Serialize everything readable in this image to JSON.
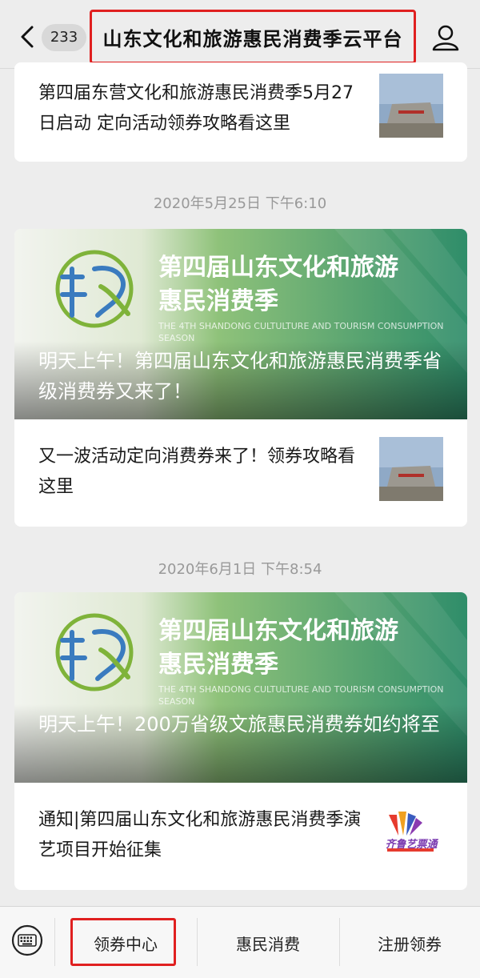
{
  "header": {
    "unread_count": "233",
    "title": "山东文化和旅游惠民消费季云平台",
    "back_icon": "chevron-left-icon",
    "profile_icon": "person-icon"
  },
  "feed": {
    "item0": {
      "text": "第四届东营文化和旅游惠民消费季5月27日启动 定向活动领券攻略看这里"
    },
    "group1": {
      "timestamp": "2020年5月25日 下午6:10",
      "banner_title_line1": "第四届山东文化和旅游",
      "banner_title_line2": "惠民消费季",
      "banner_en": "THE 4TH SHANDONG CULTULTURE AND TOURISM CONSUMPTION SEASON",
      "headline": "明天上午！第四届山东文化和旅游惠民消费季省级消费券又来了！",
      "sub_text": "又一波活动定向消费券来了！领券攻略看这里"
    },
    "group2": {
      "timestamp": "2020年6月1日 下午8:54",
      "banner_title_line1": "第四届山东文化和旅游",
      "banner_title_line2": "惠民消费季",
      "banner_en": "THE 4TH SHANDONG CULTULTURE AND TOURISM CONSUMPTION SEASON",
      "headline": "明天上午！200万省级文旅惠民消费券如约将至",
      "sub_text": "通知|第四届山东文化和旅游惠民消费季演艺项目开始征集",
      "sub_thumb_text": "齐鲁艺票通"
    }
  },
  "bottom_menu": {
    "keyboard_icon": "keyboard-icon",
    "items": [
      "领券中心",
      "惠民消费",
      "注册领券"
    ]
  },
  "colors": {
    "highlight": "#e02020",
    "banner_green": "#2f8d6a",
    "banner_light": "#a9d18e"
  }
}
